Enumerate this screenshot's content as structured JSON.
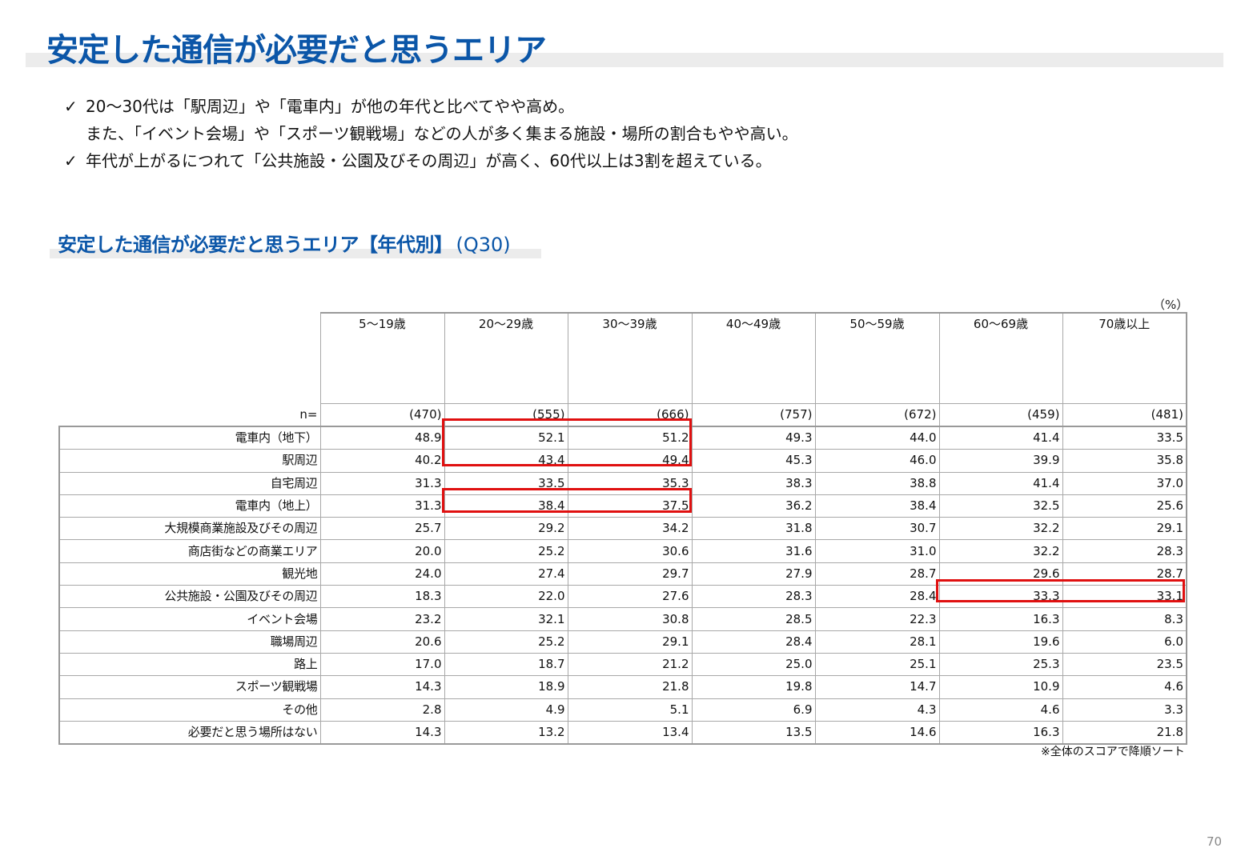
{
  "title": "安定した通信が必要だと思うエリア",
  "bullets": [
    {
      "check": "✓",
      "lines": [
        "20～30代は「駅周辺」や「電車内」が他の年代と比べてやや高め。",
        "また、「イベント会場」や「スポーツ観戦場」などの人が多く集まる施設・場所の割合もやや高い。"
      ]
    },
    {
      "check": "✓",
      "lines": [
        "年代が上がるにつれて「公共施設・公園及びその周辺」が高く、60代以上は3割を超えている。"
      ]
    }
  ],
  "section": {
    "title": "安定した通信が必要だと思うエリア【年代別】",
    "question": "(Q30)"
  },
  "table": {
    "unit": "（%）",
    "n_label": "n=",
    "columns": [
      "5～19歳",
      "20～29歳",
      "30～39歳",
      "40～49歳",
      "50～59歳",
      "60～69歳",
      "70歳以上"
    ],
    "n_values": [
      "(470)",
      "(555)",
      "(666)",
      "(757)",
      "(672)",
      "(459)",
      "(481)"
    ],
    "rows": [
      {
        "label": "電車内（地下）",
        "values": [
          "48.9",
          "52.1",
          "51.2",
          "49.3",
          "44.0",
          "41.4",
          "33.5"
        ]
      },
      {
        "label": "駅周辺",
        "values": [
          "40.2",
          "43.4",
          "49.4",
          "45.3",
          "46.0",
          "39.9",
          "35.8"
        ]
      },
      {
        "label": "自宅周辺",
        "values": [
          "31.3",
          "33.5",
          "35.3",
          "38.3",
          "38.8",
          "41.4",
          "37.0"
        ]
      },
      {
        "label": "電車内（地上）",
        "values": [
          "31.3",
          "38.4",
          "37.5",
          "36.2",
          "38.4",
          "32.5",
          "25.6"
        ]
      },
      {
        "label": "大規模商業施設及びその周辺",
        "values": [
          "25.7",
          "29.2",
          "34.2",
          "31.8",
          "30.7",
          "32.2",
          "29.1"
        ]
      },
      {
        "label": "商店街などの商業エリア",
        "values": [
          "20.0",
          "25.2",
          "30.6",
          "31.6",
          "31.0",
          "32.2",
          "28.3"
        ]
      },
      {
        "label": "観光地",
        "values": [
          "24.0",
          "27.4",
          "29.7",
          "27.9",
          "28.7",
          "29.6",
          "28.7"
        ]
      },
      {
        "label": "公共施設・公園及びその周辺",
        "values": [
          "18.3",
          "22.0",
          "27.6",
          "28.3",
          "28.4",
          "33.3",
          "33.1"
        ]
      },
      {
        "label": "イベント会場",
        "values": [
          "23.2",
          "32.1",
          "30.8",
          "28.5",
          "22.3",
          "16.3",
          "8.3"
        ]
      },
      {
        "label": "職場周辺",
        "values": [
          "20.6",
          "25.2",
          "29.1",
          "28.4",
          "28.1",
          "19.6",
          "6.0"
        ]
      },
      {
        "label": "路上",
        "values": [
          "17.0",
          "18.7",
          "21.2",
          "25.0",
          "25.1",
          "25.3",
          "23.5"
        ]
      },
      {
        "label": "スポーツ観戦場",
        "values": [
          "14.3",
          "18.9",
          "21.8",
          "19.8",
          "14.7",
          "10.9",
          "4.6"
        ]
      },
      {
        "label": "その他",
        "values": [
          "2.8",
          "4.9",
          "5.1",
          "6.9",
          "4.3",
          "4.6",
          "3.3"
        ]
      },
      {
        "label": "必要だと思う場所はない",
        "values": [
          "14.3",
          "13.2",
          "13.4",
          "13.5",
          "14.6",
          "16.3",
          "21.8"
        ]
      }
    ],
    "highlight_color": "#e01010"
  },
  "footnote": "※全体のスコアで降順ソート",
  "page_number": "70",
  "colors": {
    "title": "#0b56a8",
    "band": "#ececec"
  }
}
